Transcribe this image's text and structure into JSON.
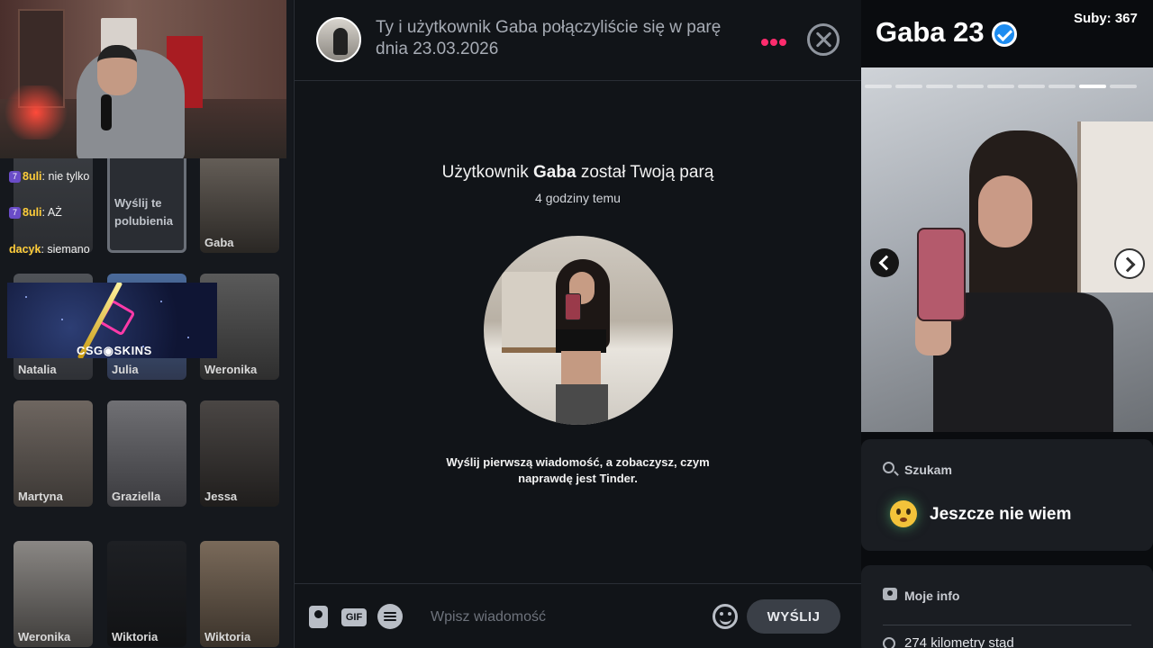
{
  "webcam": {
    "label": "streamer webcam"
  },
  "stream_overlay": {
    "chat": [
      {
        "badge": "7",
        "user": "8uli",
        "text": "nie tylko"
      },
      {
        "badge": "7",
        "user": "8uli",
        "text": "AŻ"
      },
      {
        "badge": "",
        "user": "dacyk",
        "text": "siemano"
      }
    ],
    "subs": "Suby: 367",
    "promo_logo": "CSG◉SKINS"
  },
  "matches": {
    "likes_card": "Wyślij te polubienia",
    "cards": [
      "Gaba",
      "Natalia",
      "Julia",
      "Weronika",
      "Martyna",
      "Graziella",
      "Jessa",
      "Weronika",
      "Wiktoria",
      "Wiktoria"
    ]
  },
  "conversation": {
    "header_text": "Ty i użytkownik Gaba połączyliście się w parę dnia 23.03.2026",
    "title_prefix": "Użytkownik ",
    "title_name": "Gaba",
    "title_suffix": " został Twoją parą",
    "time": "4 godziny temu",
    "first_message_prompt": "Wyślij pierwszą wiadomość, a zobaczysz, czym naprawdę jest Tinder.",
    "input_placeholder": "Wpisz wiadomość",
    "gif_label": "GIF",
    "send_label": "WYŚLIJ",
    "colors": {
      "accent": "#fd2c6d",
      "verified": "#1d8cf0"
    }
  },
  "profile": {
    "name": "Gaba",
    "age": "23",
    "photo_count": 9,
    "current_photo": 8,
    "looking_for_title": "Szukam",
    "looking_for_value": "Jeszcze nie wiem",
    "info_title": "Moje info",
    "distance": "274 kilometry stąd"
  }
}
